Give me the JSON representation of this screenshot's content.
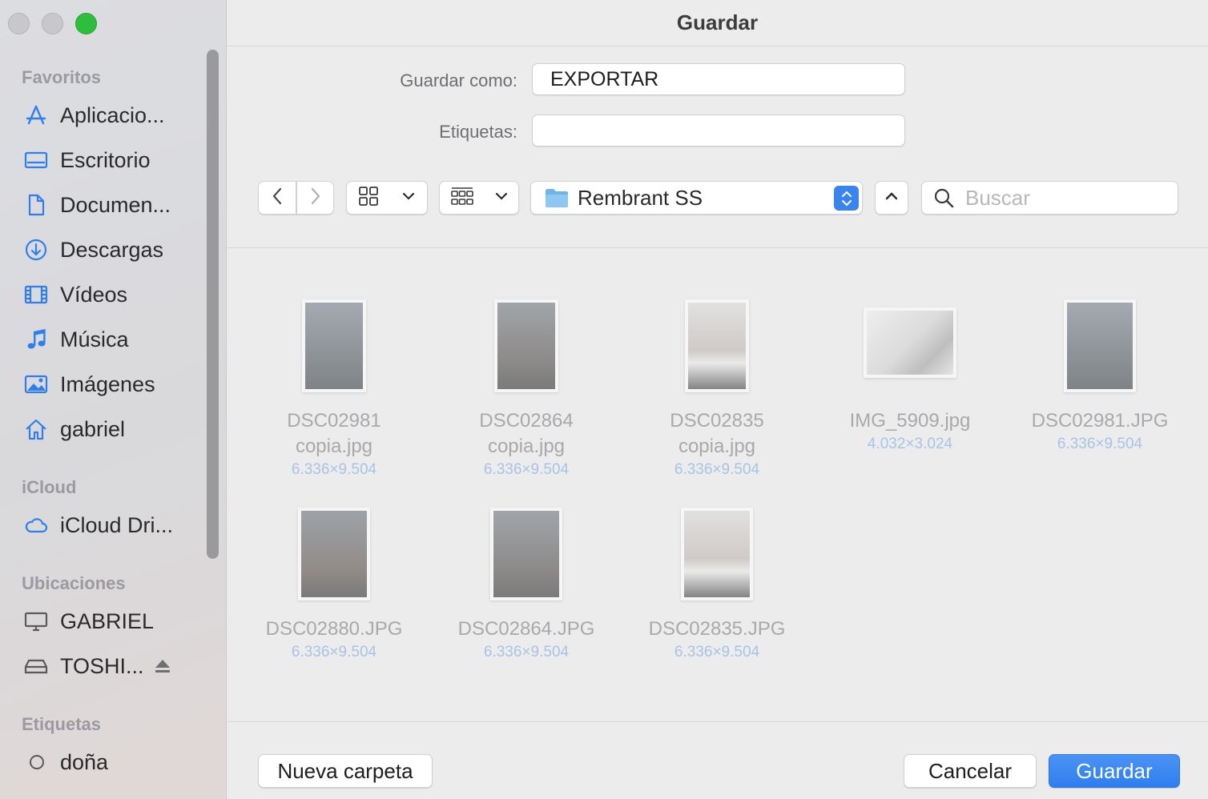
{
  "window": {
    "title": "Guardar"
  },
  "sidebar": {
    "sections": [
      {
        "title": "Favoritos",
        "items": [
          {
            "label": "Aplicacio...",
            "icon": "applications-icon"
          },
          {
            "label": "Escritorio",
            "icon": "desktop-icon"
          },
          {
            "label": "Documen...",
            "icon": "document-icon"
          },
          {
            "label": "Descargas",
            "icon": "download-icon"
          },
          {
            "label": "Vídeos",
            "icon": "film-icon"
          },
          {
            "label": "Música",
            "icon": "music-note-icon"
          },
          {
            "label": "Imágenes",
            "icon": "photo-icon"
          },
          {
            "label": "gabriel",
            "icon": "home-icon"
          }
        ]
      },
      {
        "title": "iCloud",
        "items": [
          {
            "label": "iCloud Dri...",
            "icon": "cloud-icon"
          }
        ]
      },
      {
        "title": "Ubicaciones",
        "items": [
          {
            "label": "GABRIEL",
            "icon": "computer-icon"
          },
          {
            "label": "TOSHI...",
            "icon": "external-drive-icon"
          }
        ]
      },
      {
        "title": "Etiquetas",
        "items": [
          {
            "label": "doña",
            "icon": "tag-circle-icon"
          }
        ]
      }
    ]
  },
  "form": {
    "save_as_label": "Guardar como:",
    "save_as_value": "EXPORTAR",
    "tags_label": "Etiquetas:",
    "tags_value": ""
  },
  "toolbar": {
    "location": "Rembrant SS",
    "search_placeholder": "Buscar"
  },
  "files": [
    {
      "name": "DSC02981\ncopia.jpg",
      "dims": "6.336×9.504",
      "kind": "portrait-dark"
    },
    {
      "name": "DSC02864\ncopia.jpg",
      "dims": "6.336×9.504",
      "kind": "portrait-dark"
    },
    {
      "name": "DSC02835\ncopia.jpg",
      "dims": "6.336×9.504",
      "kind": "portrait-light"
    },
    {
      "name": "IMG_5909.jpg",
      "dims": "4.032×3.024",
      "kind": "landscape-studio"
    },
    {
      "name": "DSC02981.JPG",
      "dims": "6.336×9.504",
      "kind": "portrait-dark"
    },
    {
      "name": "DSC02880.JPG",
      "dims": "6.336×9.504",
      "kind": "portrait-dark"
    },
    {
      "name": "DSC02864.JPG",
      "dims": "6.336×9.504",
      "kind": "portrait-dark"
    },
    {
      "name": "DSC02835.JPG",
      "dims": "6.336×9.504",
      "kind": "portrait-light"
    }
  ],
  "footer": {
    "new_folder": "Nueva carpeta",
    "cancel": "Cancelar",
    "save": "Guardar"
  },
  "colors": {
    "accent": "#2f7ef0",
    "sidebar_icon": "#2f7ef0"
  }
}
